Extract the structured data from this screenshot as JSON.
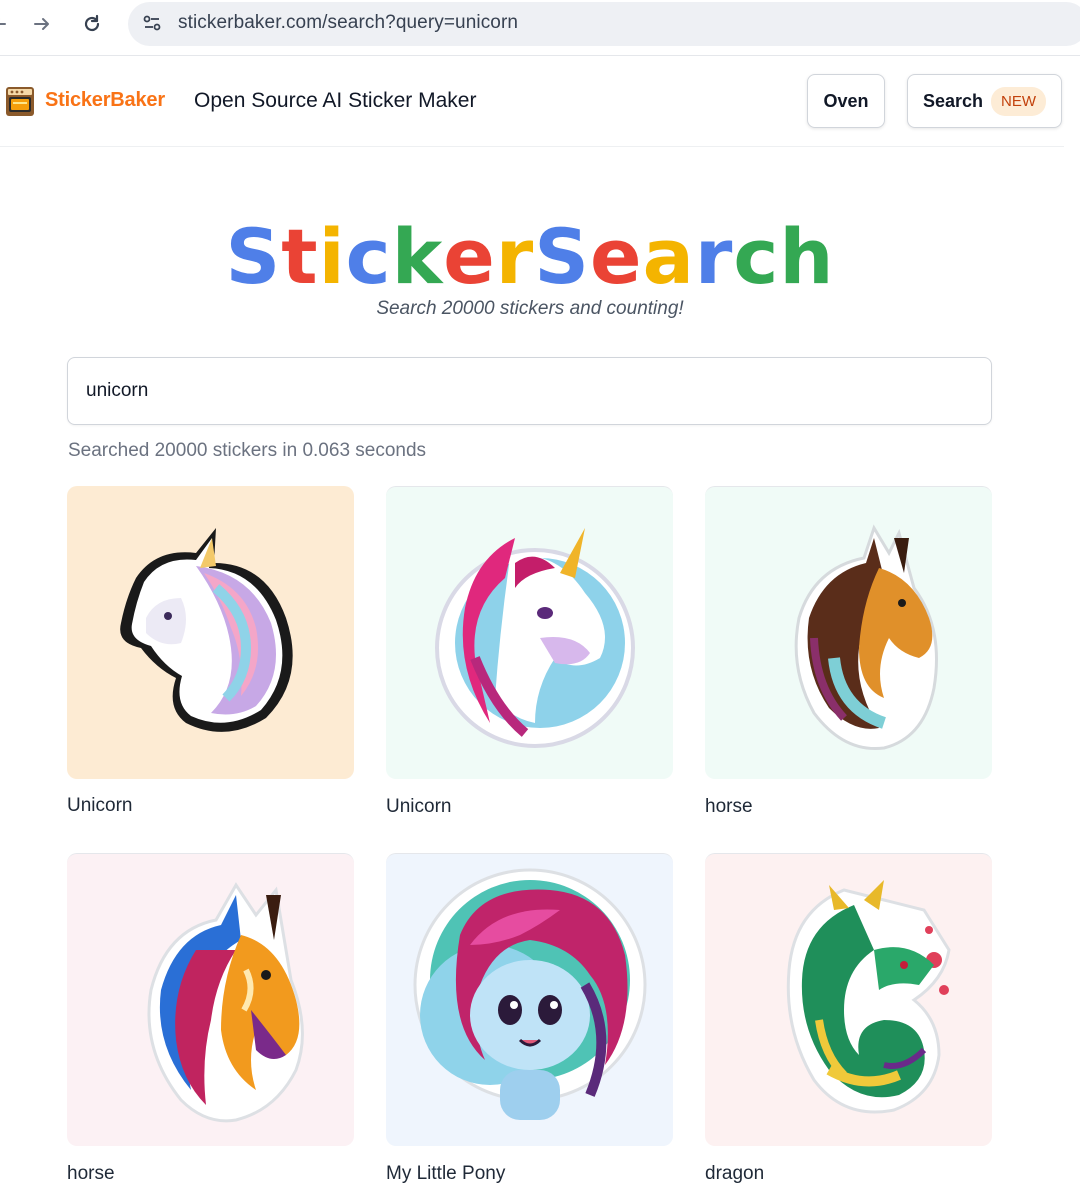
{
  "browser": {
    "url": "stickerbaker.com/search?query=unicorn"
  },
  "header": {
    "logo_text": "StickerBaker",
    "tagline": "Open Source AI Sticker Maker",
    "oven_label": "Oven",
    "search_label": "Search",
    "search_badge": "NEW"
  },
  "hero": {
    "title_letters": [
      {
        "ch": "S",
        "color": "#4f7fe8"
      },
      {
        "ch": "t",
        "color": "#ea4335"
      },
      {
        "ch": "i",
        "color": "#f4b400"
      },
      {
        "ch": "c",
        "color": "#4f7fe8"
      },
      {
        "ch": "k",
        "color": "#34a853"
      },
      {
        "ch": "e",
        "color": "#ea4335"
      },
      {
        "ch": "r",
        "color": "#f4b400"
      },
      {
        "ch": "S",
        "color": "#4f7fe8"
      },
      {
        "ch": "e",
        "color": "#ea4335"
      },
      {
        "ch": "a",
        "color": "#f4b400"
      },
      {
        "ch": "r",
        "color": "#4f7fe8"
      },
      {
        "ch": "c",
        "color": "#34a853"
      },
      {
        "ch": "h",
        "color": "#34a853"
      }
    ],
    "subtitle": "Search 20000 stickers and counting!"
  },
  "search": {
    "value": "unicorn",
    "stats": "Searched 20000 stickers in 0.063 seconds"
  },
  "results": [
    {
      "label": "Unicorn",
      "icon": "unicorn-sticker-icon",
      "bg": "#fdebd3"
    },
    {
      "label": "Unicorn",
      "icon": "unicorn-circle-sticker-icon",
      "bg": "#f0fbf7"
    },
    {
      "label": "horse",
      "icon": "horse-sticker-icon",
      "bg": "#f0fbf7"
    },
    {
      "label": "horse",
      "icon": "colorful-horse-sticker-icon",
      "bg": "#fcf1f4"
    },
    {
      "label": "My Little Pony",
      "icon": "pony-sticker-icon",
      "bg": "#eff5fd"
    },
    {
      "label": "dragon",
      "icon": "dragon-sticker-icon",
      "bg": "#fdf1f1"
    }
  ]
}
